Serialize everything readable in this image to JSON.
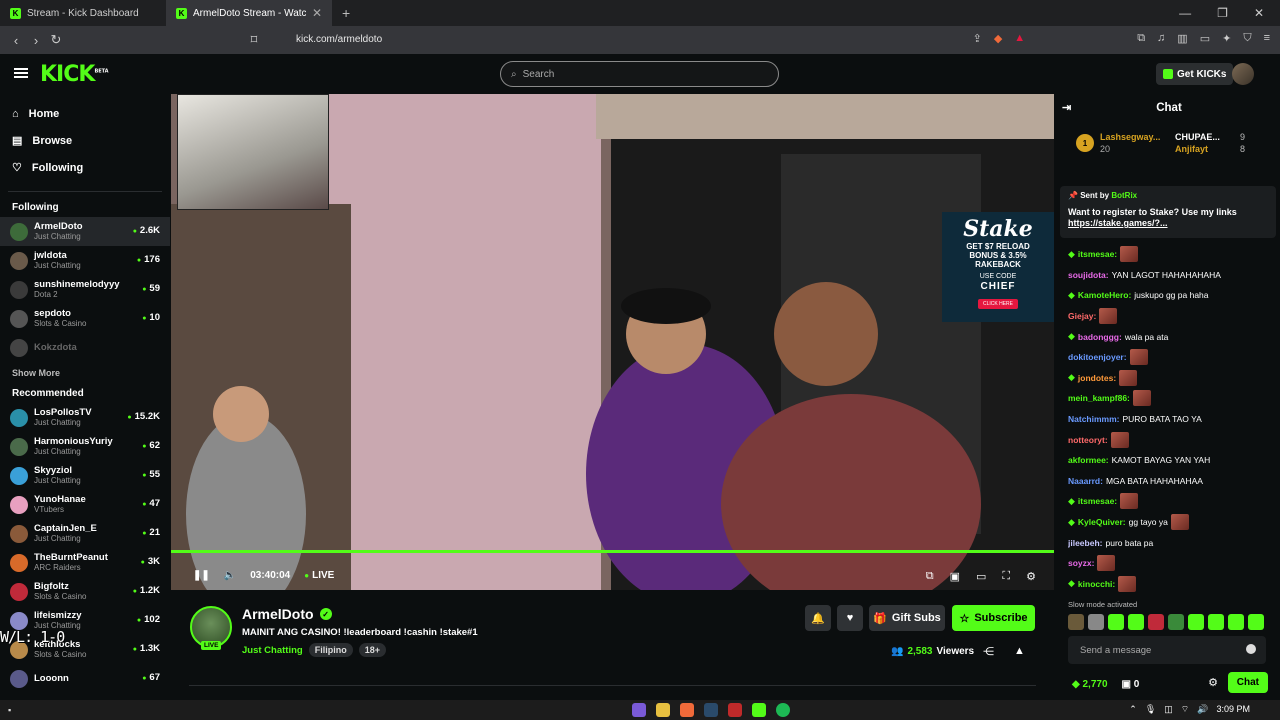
{
  "browser": {
    "tabs": [
      {
        "title": "Stream - Kick Dashboard",
        "active": false
      },
      {
        "title": "ArmelDoto Stream - Watch Li",
        "active": true
      }
    ],
    "url": "kick.com/armeldoto"
  },
  "header": {
    "logo": "KICK",
    "logo_badge": "BETA",
    "search_placeholder": "Search",
    "get_kicks": "Get KICKs"
  },
  "sidebar": {
    "nav": [
      {
        "label": "Home",
        "icon": "home-icon"
      },
      {
        "label": "Browse",
        "icon": "browse-icon"
      },
      {
        "label": "Following",
        "icon": "heart-icon"
      }
    ],
    "following_title": "Following",
    "following": [
      {
        "name": "ArmelDoto",
        "category": "Just Chatting",
        "viewers": "2.6K",
        "color": "#3d6b3a"
      },
      {
        "name": "jwldota",
        "category": "Just Chatting",
        "viewers": "176",
        "color": "#6a5a4a"
      },
      {
        "name": "sunshinemelodyyy",
        "category": "Dota 2",
        "viewers": "59",
        "color": "#3a3a3a"
      },
      {
        "name": "sepdoto",
        "category": "Slots & Casino",
        "viewers": "10",
        "color": "#555"
      },
      {
        "name": "Kokzdota",
        "category": "",
        "viewers": "",
        "color": "#444",
        "offline": true
      }
    ],
    "show_more": "Show More",
    "recommended_title": "Recommended",
    "recommended": [
      {
        "name": "LosPollosTV",
        "category": "Just Chatting",
        "viewers": "15.2K",
        "color": "#2a8fa8"
      },
      {
        "name": "HarmoniousYuriy",
        "category": "Just Chatting",
        "viewers": "62",
        "color": "#4a6a4a"
      },
      {
        "name": "Skyyziol",
        "category": "Just Chatting",
        "viewers": "55",
        "color": "#3aa0d8"
      },
      {
        "name": "YunoHanae",
        "category": "VTubers",
        "viewers": "47",
        "color": "#e8a0c0"
      },
      {
        "name": "CaptainJen_E",
        "category": "Just Chatting",
        "viewers": "21",
        "color": "#8a5a3a"
      },
      {
        "name": "TheBurntPeanut",
        "category": "ARC Raiders",
        "viewers": "3K",
        "color": "#d86a2a"
      },
      {
        "name": "Bigfoltz",
        "category": "Slots & Casino",
        "viewers": "1.2K",
        "color": "#c02a3a"
      },
      {
        "name": "lifeismizzy",
        "category": "Just Chatting",
        "viewers": "102",
        "color": "#8a8ac8"
      },
      {
        "name": "keithlocks",
        "category": "Slots & Casino",
        "viewers": "1.3K",
        "color": "#b88a4a"
      },
      {
        "name": "Looonn",
        "category": "",
        "viewers": "67",
        "color": "#5a5a8a"
      }
    ],
    "overlay_text": "W/L: 1-0"
  },
  "player": {
    "time": "03:40:04",
    "live_label": "LIVE",
    "ad": {
      "brand": "Stake",
      "line1": "GET $7 RELOAD",
      "line2": "BONUS & 3.5%",
      "line3": "RAKEBACK",
      "line4": "USE CODE",
      "code": "CHIEF",
      "button": "CLICK HERE"
    }
  },
  "stream_info": {
    "name": "ArmelDoto",
    "live_badge": "LIVE",
    "title": "MAINIT ANG CASINO! !leaderboard !cashin !stake#1",
    "category": "Just Chatting",
    "tags": [
      "Filipino",
      "18+"
    ],
    "gift_subs": "Gift Subs",
    "subscribe": "Subscribe",
    "viewers_count": "2,583",
    "viewers_label": "Viewers"
  },
  "chat": {
    "title": "Chat",
    "leaderboard": {
      "rank": "1",
      "first_name": "Lashsegway...",
      "first_score": "20",
      "second_name": "CHUPAE...",
      "second_score": "9",
      "third_name": "Anjifayt",
      "third_score": "8"
    },
    "pinned": {
      "sent_by": "Sent by",
      "bot": "BotRix",
      "message": "Want to register to Stake? Use my links",
      "link": "https://stake.games/?..."
    },
    "messages": [
      {
        "user": "itsmesae:",
        "text": "",
        "color": "#53fc18",
        "badge": true,
        "emote": true
      },
      {
        "user": "soujidota:",
        "text": "YAN LAGOT HAHAHAHAHA",
        "color": "#e86ae8",
        "badge": false,
        "emote": false
      },
      {
        "user": "KamoteHero:",
        "text": "juskupo gg pa haha",
        "color": "#53fc18",
        "badge": true,
        "emote": false
      },
      {
        "user": "Giejay:",
        "text": "",
        "color": "#ff6a6a",
        "badge": false,
        "emote": true
      },
      {
        "user": "badonggg:",
        "text": "wala pa ata",
        "color": "#e86ae8",
        "badge": true,
        "emote": false
      },
      {
        "user": "dokitoenjoyer:",
        "text": "",
        "color": "#6a9aff",
        "badge": false,
        "emote": true
      },
      {
        "user": "jondotes:",
        "text": "",
        "color": "#ff9a3a",
        "badge": true,
        "emote": true
      },
      {
        "user": "mein_kampf86:",
        "text": "",
        "color": "#53fc18",
        "badge": false,
        "emote": true
      },
      {
        "user": "Natchimmm:",
        "text": "PURO BATA TAO YA",
        "color": "#6a9aff",
        "badge": false,
        "emote": false
      },
      {
        "user": "notteoryt:",
        "text": "",
        "color": "#ff6a6a",
        "badge": false,
        "emote": true
      },
      {
        "user": "akformee:",
        "text": "KAMOT BAYAG YAN YAH",
        "color": "#53fc18",
        "badge": false,
        "emote": false
      },
      {
        "user": "Naaarrd:",
        "text": "MGA BATA HAHAHAHAA",
        "color": "#6a9aff",
        "badge": false,
        "emote": false
      },
      {
        "user": "itsmesae:",
        "text": "",
        "color": "#53fc18",
        "badge": true,
        "emote": true
      },
      {
        "user": "KyleQuiver:",
        "text": "gg tayo ya",
        "color": "#53fc18",
        "badge": true,
        "emote": true
      },
      {
        "user": "jileebeh:",
        "text": "puro bata pa",
        "color": "#c8c8ff",
        "badge": false,
        "emote": false
      },
      {
        "user": "soyzx:",
        "text": "",
        "color": "#e86ae8",
        "badge": false,
        "emote": true
      },
      {
        "user": "kinocchi:",
        "text": "",
        "color": "#53fc18",
        "badge": true,
        "emote": true
      }
    ],
    "slow_mode": "Slow mode activated",
    "input_placeholder": "Send a message",
    "points": "2,770",
    "gifts": "0",
    "send_button": "Chat"
  },
  "taskbar": {
    "time": "3:09 PM"
  }
}
